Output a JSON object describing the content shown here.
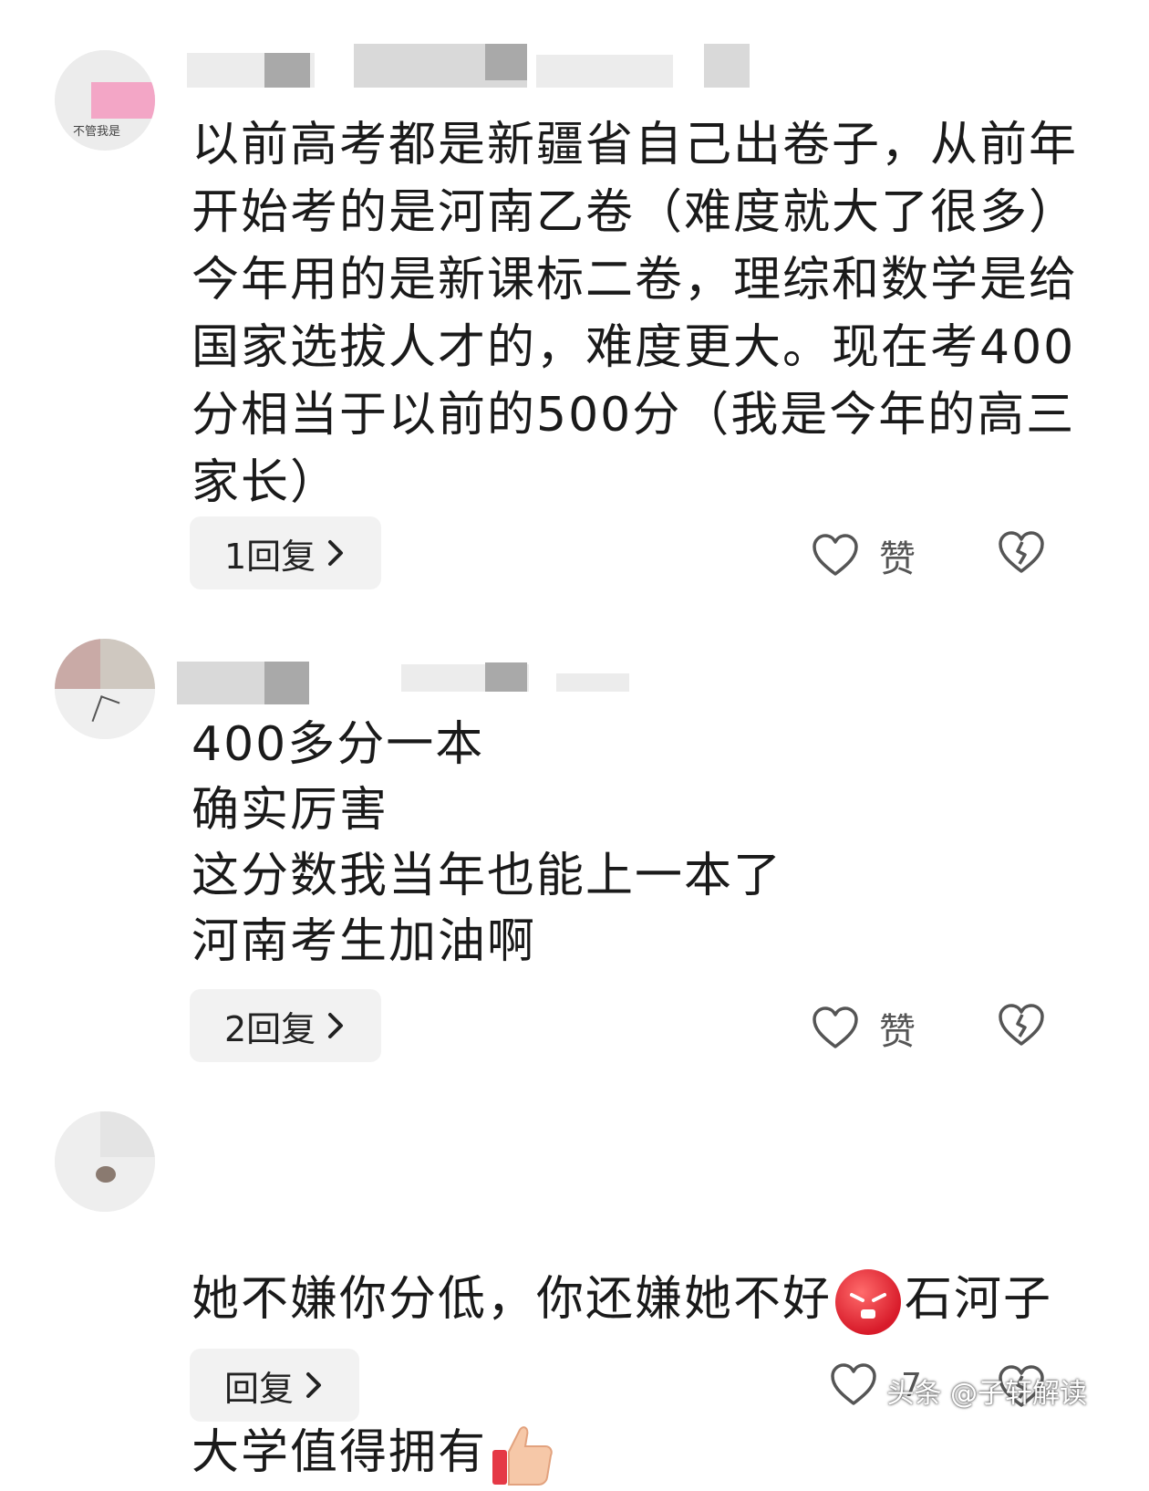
{
  "comments": [
    {
      "text": "以前高考都是新疆省自己出卷子，从前年开始考的是河南乙卷（难度就大了很多）今年用的是新课标二卷，理综和数学是给国家选拔人才的，难度更大。现在考400分相当于以前的500分（我是今年的高三家长）",
      "reply_label": "1回复",
      "like_label": "赞",
      "avatar_text": "不管我是"
    },
    {
      "text": "400多分一本\n确实厉害\n这分数我当年也能上一本了\n河南考生加油啊",
      "reply_label": "2回复",
      "like_label": "赞"
    },
    {
      "text_part1": "她不嫌你分低，你还嫌她不好",
      "text_part2": "石河子",
      "text_part3": "大学值得拥有",
      "reply_label": "回复",
      "like_label": "7"
    }
  ],
  "watermark": "头条 @子轩解读",
  "icons": [
    "heart-outline-icon",
    "broken-heart-icon",
    "chevron-right-icon",
    "angry-face-emoji",
    "thumbs-up-emoji"
  ],
  "colors": {
    "text": "#1a1a1a",
    "reply_bg": "#f2f2f2",
    "icon": "#555555"
  }
}
